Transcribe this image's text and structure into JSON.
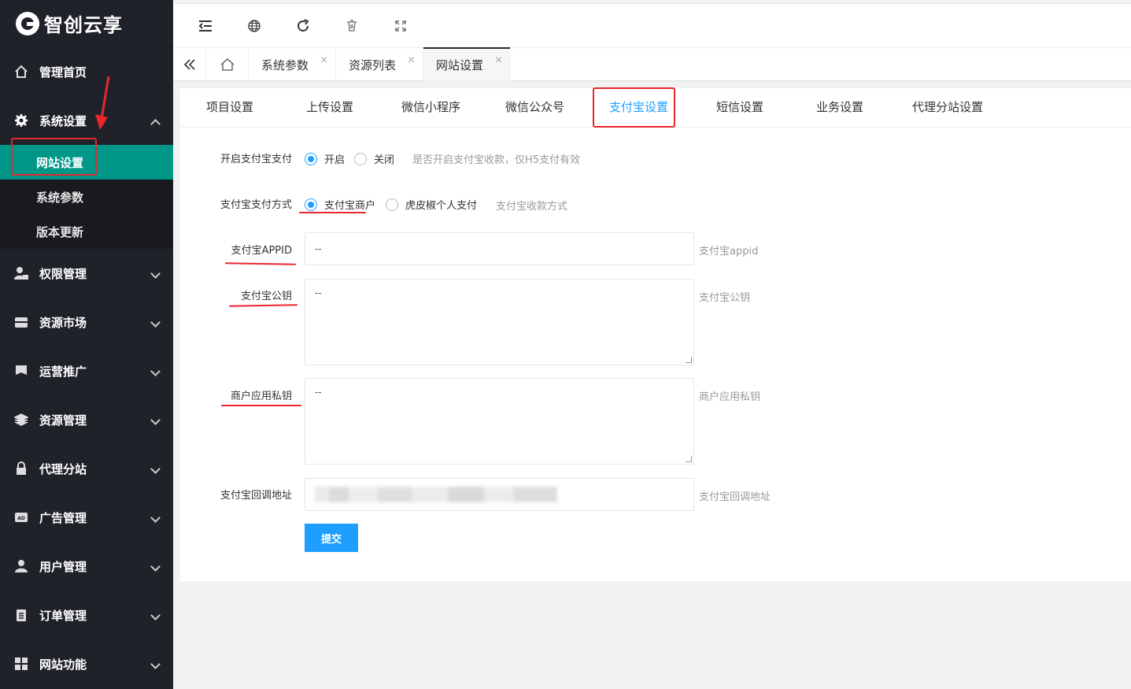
{
  "app": {
    "logo_text": "智创云享"
  },
  "sidebar": {
    "home": "管理首页",
    "system": "系统设置",
    "system_sub": [
      "网站设置",
      "系统参数",
      "版本更新"
    ],
    "items": [
      "权限管理",
      "资源市场",
      "运营推广",
      "资源管理",
      "代理分站",
      "广告管理",
      "用户管理",
      "订单管理",
      "网站功能"
    ]
  },
  "header": {
    "icons": [
      "menu-fold-icon",
      "globe-icon",
      "refresh-icon",
      "trash-icon",
      "fullscreen-icon"
    ]
  },
  "page_tabs": [
    {
      "label": "系统参数",
      "close": "×"
    },
    {
      "label": "资源列表",
      "close": "×"
    },
    {
      "label": "网站设置",
      "close": "×"
    }
  ],
  "settings_tabs": [
    "项目设置",
    "上传设置",
    "微信小程序",
    "微信公众号",
    "支付宝设置",
    "短信设置",
    "业务设置",
    "代理分站设置"
  ],
  "form": {
    "enable": {
      "label": "开启支付宝支付",
      "on": "开启",
      "off": "关闭",
      "tip": "是否开启支付宝收款，仅H5支付有效"
    },
    "mode": {
      "label": "支付宝支付方式",
      "opt1": "支付宝商户",
      "opt2": "虎皮椒个人支付",
      "tip": "支付宝收款方式"
    },
    "appid": {
      "label": "支付宝APPID",
      "value": "--",
      "tip": "支付宝appid"
    },
    "pubkey": {
      "label": "支付宝公钥",
      "value": "--",
      "tip": "支付宝公钥"
    },
    "privkey": {
      "label": "商户应用私钥",
      "value": "--",
      "tip": "商户应用私钥"
    },
    "callback": {
      "label": "支付宝回调地址",
      "tip": "支付宝回调地址"
    },
    "submit": "提交"
  },
  "colors": {
    "accent": "#1e9fff",
    "sidebar": "#20222a",
    "active": "#009688",
    "annotation": "#e8262d"
  }
}
